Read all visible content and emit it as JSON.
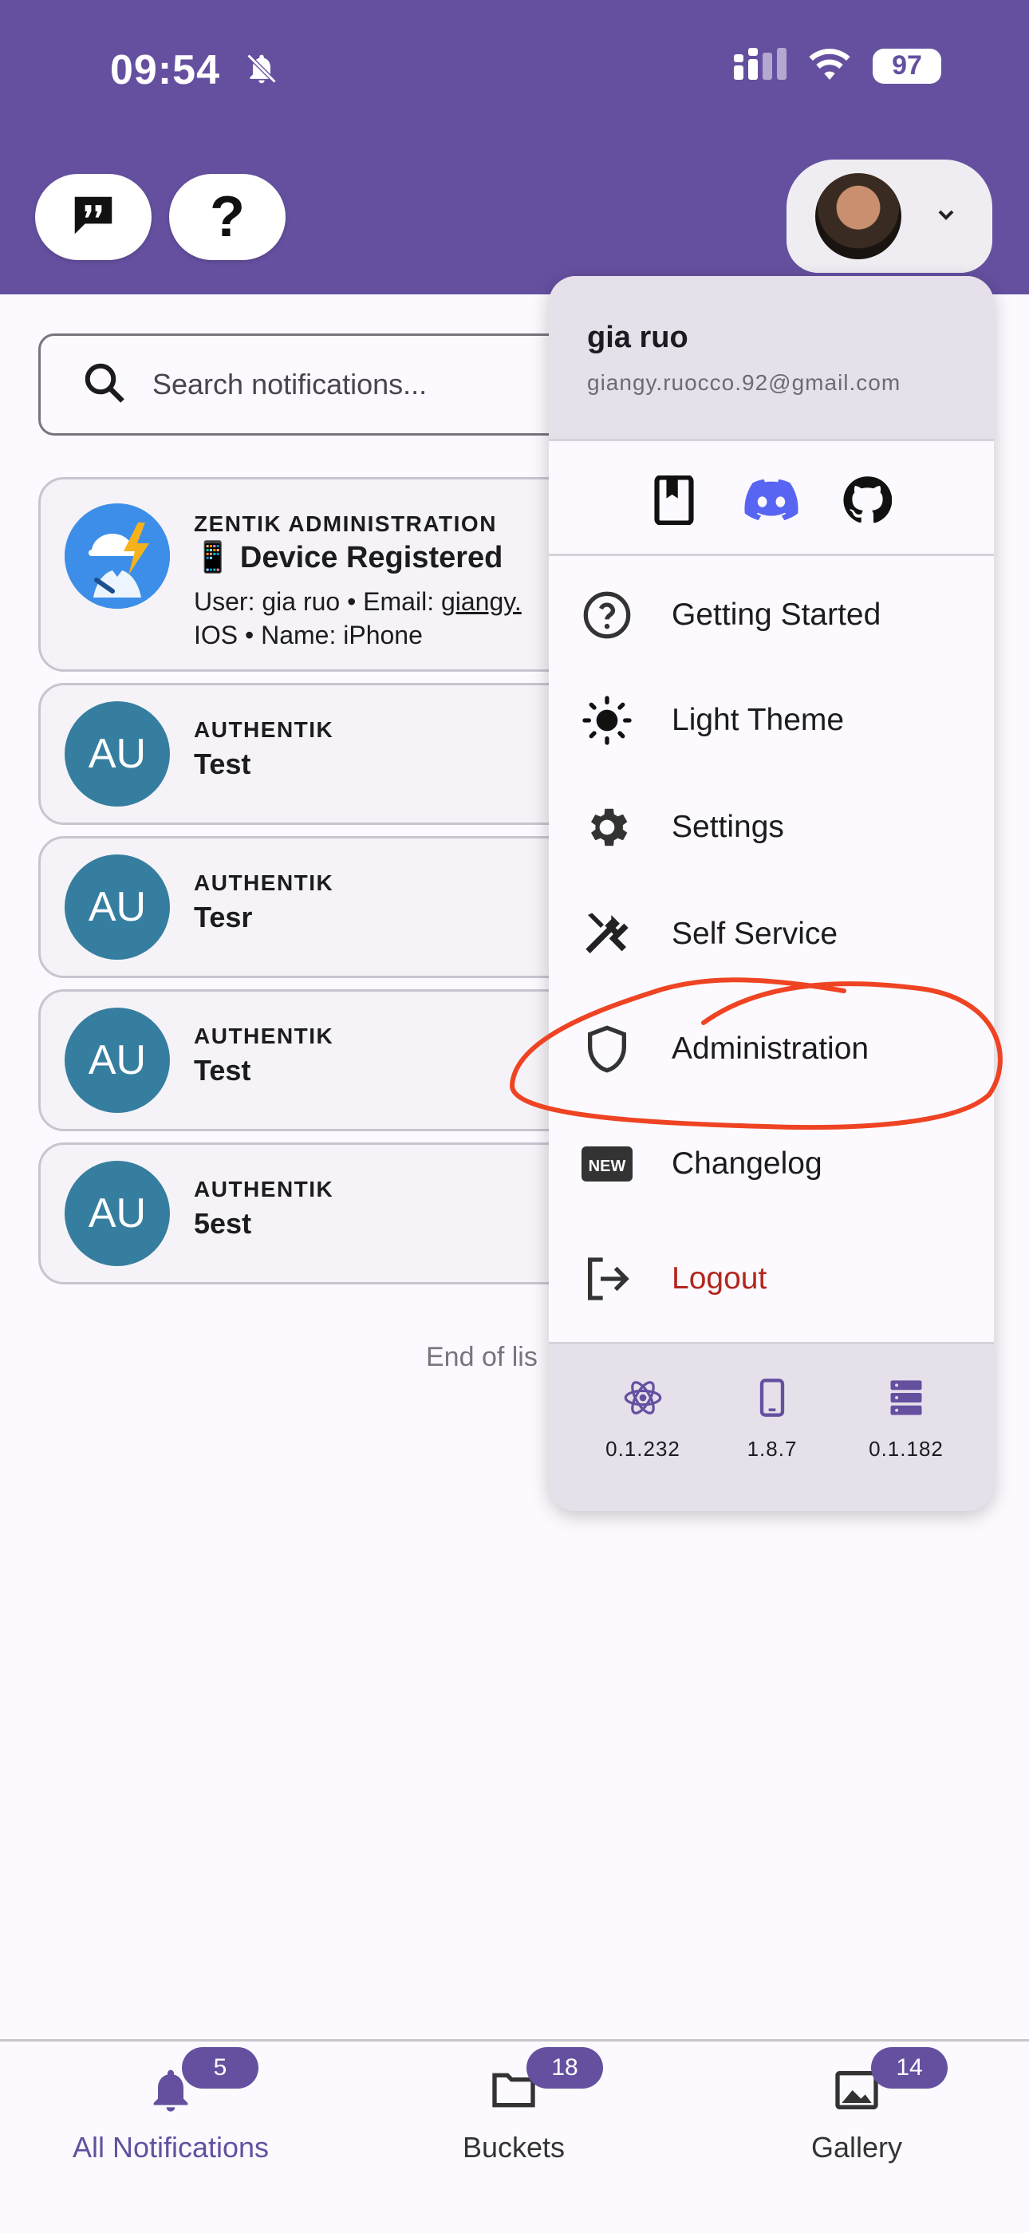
{
  "status_bar": {
    "time": "09:54",
    "battery": "97"
  },
  "search": {
    "placeholder": "Search notifications..."
  },
  "notifications": [
    {
      "source": "ZENTIK ADMINISTRATION",
      "title": "📱 Device Registered",
      "body_line1_prefix": "User: gia ruo • Email: ",
      "body_line1_link": "giangy.",
      "body_line2": "IOS • Name: iPhone"
    },
    {
      "avatar": "AU",
      "source": "AUTHENTIK",
      "title": "Test"
    },
    {
      "avatar": "AU",
      "source": "AUTHENTIK",
      "title": "Tesr"
    },
    {
      "avatar": "AU",
      "source": "AUTHENTIK",
      "title": "Test"
    },
    {
      "avatar": "AU",
      "source": "AUTHENTIK",
      "title": "5est"
    }
  ],
  "end_of_list": "End of lis",
  "menu": {
    "name": "gia ruo",
    "email": "giangy.ruocco.92@gmail.com",
    "items": [
      {
        "label": "Getting Started",
        "icon": "help-circle-icon"
      },
      {
        "label": "Light Theme",
        "icon": "sun-icon"
      },
      {
        "label": "Settings",
        "icon": "gear-icon"
      },
      {
        "label": "Self Service",
        "icon": "tools-icon"
      },
      {
        "label": "Administration",
        "icon": "shield-icon"
      },
      {
        "label": "Changelog",
        "icon": "new-badge-icon"
      },
      {
        "label": "Logout",
        "icon": "logout-icon"
      }
    ],
    "versions": [
      {
        "icon": "react-icon",
        "label": "0.1.232"
      },
      {
        "icon": "phone-icon",
        "label": "1.8.7"
      },
      {
        "icon": "server-icon",
        "label": "0.1.182"
      }
    ]
  },
  "bottom_nav": [
    {
      "label": "All Notifications",
      "badge": "5"
    },
    {
      "label": "Buckets",
      "badge": "18"
    },
    {
      "label": "Gallery",
      "badge": "14"
    }
  ],
  "colors": {
    "primary": "#6550a0",
    "logout": "#b3261e",
    "annotation": "#ef4423",
    "avatar": "#367ea0"
  }
}
